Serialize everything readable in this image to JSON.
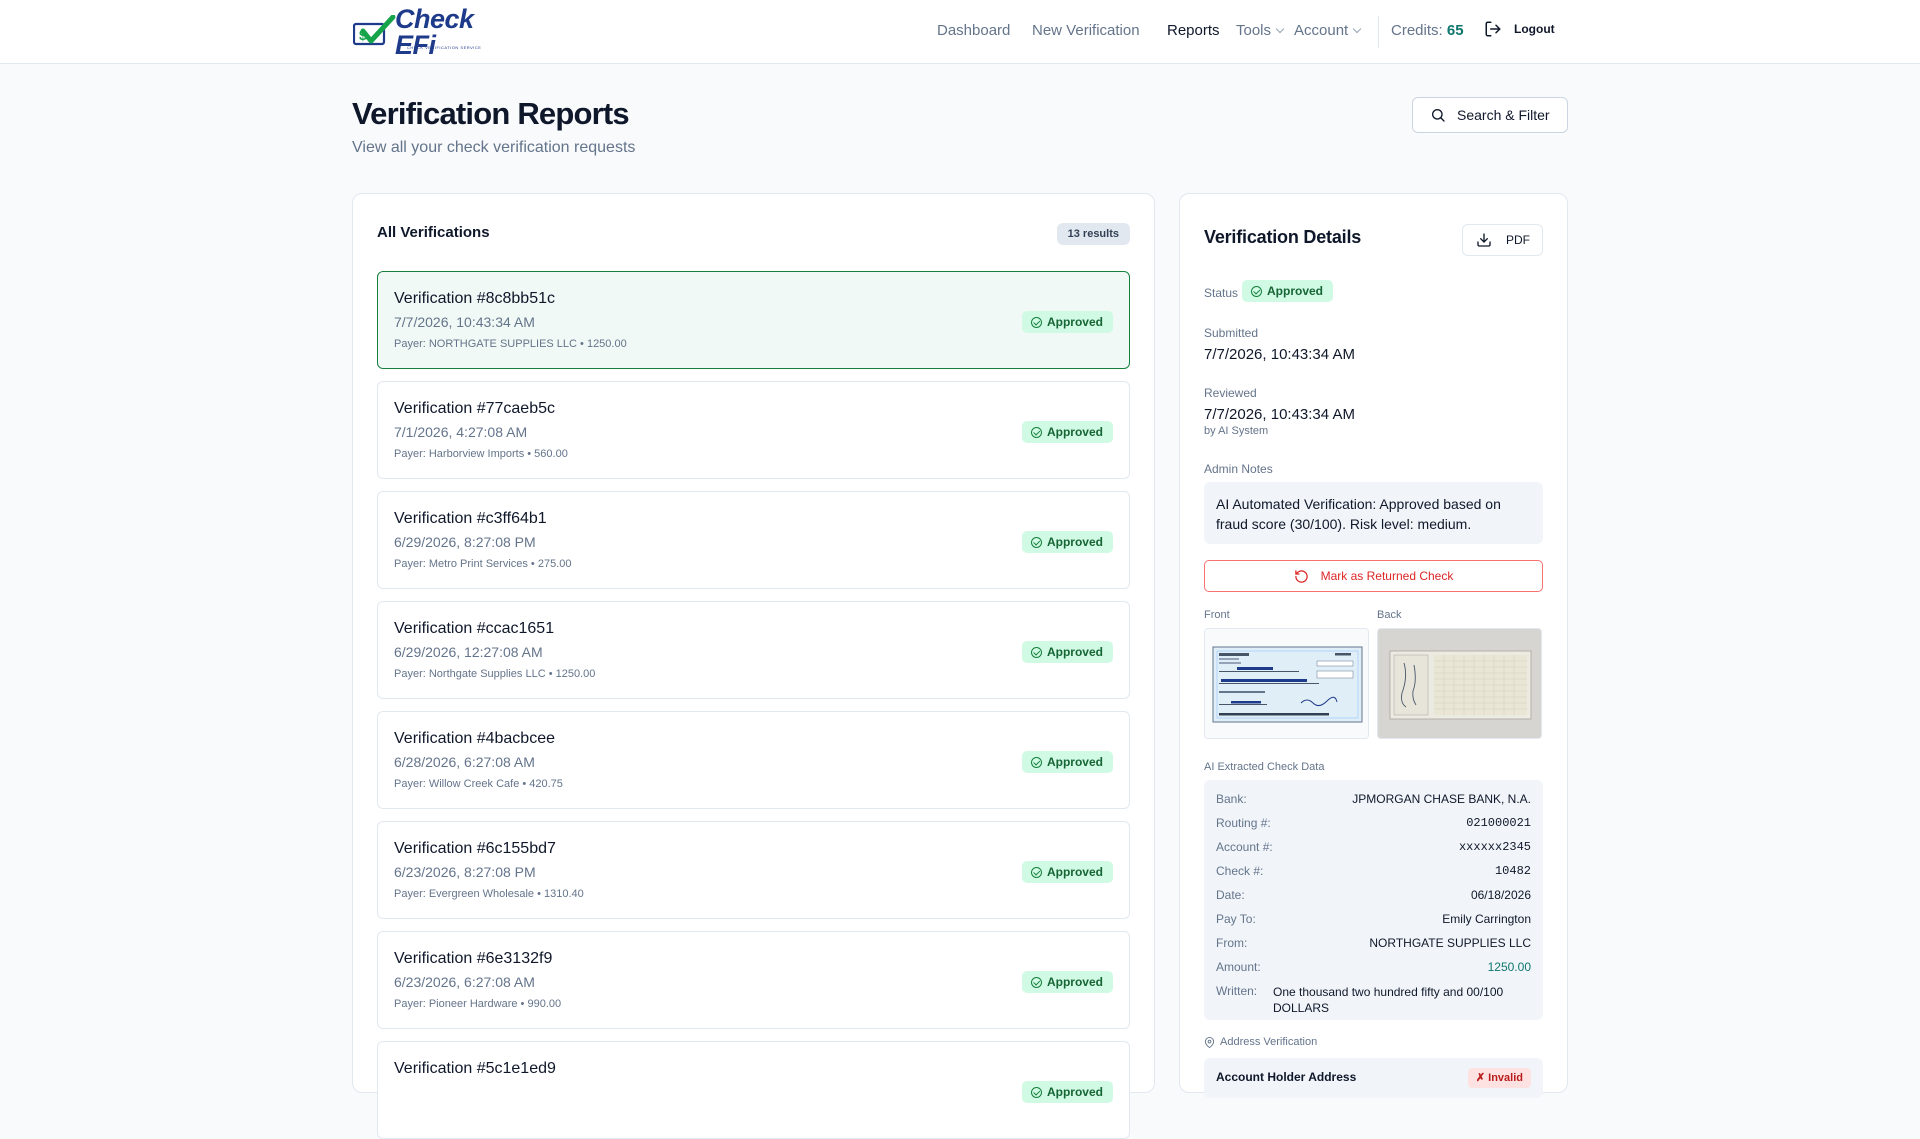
{
  "nav": {
    "logo_text": "Check EFi",
    "logo_sub": "CHECK VERIFICATION SERVICE",
    "links": [
      "Dashboard",
      "New Verification",
      "Reports",
      "Tools",
      "Account"
    ],
    "credits_label": "Credits:",
    "credits_value": "65",
    "logout": "Logout"
  },
  "header": {
    "title": "Verification Reports",
    "subtitle": "View all your check verification requests",
    "search_button": "Search & Filter"
  },
  "list": {
    "title": "All Verifications",
    "count": "13 results",
    "items": [
      {
        "title": "Verification #8c8bb51c",
        "date": "7/7/2026, 10:43:34 AM",
        "payer": "Payer: NORTHGATE SUPPLIES LLC • 1250.00",
        "status": "Approved"
      },
      {
        "title": "Verification #77caeb5c",
        "date": "7/1/2026, 4:27:08 AM",
        "payer": "Payer: Harborview Imports • 560.00",
        "status": "Approved"
      },
      {
        "title": "Verification #c3ff64b1",
        "date": "6/29/2026, 8:27:08 PM",
        "payer": "Payer: Metro Print Services • 275.00",
        "status": "Approved"
      },
      {
        "title": "Verification #ccac1651",
        "date": "6/29/2026, 12:27:08 AM",
        "payer": "Payer: Northgate Supplies LLC • 1250.00",
        "status": "Approved"
      },
      {
        "title": "Verification #4bacbcee",
        "date": "6/28/2026, 6:27:08 AM",
        "payer": "Payer: Willow Creek Cafe • 420.75",
        "status": "Approved"
      },
      {
        "title": "Verification #6c155bd7",
        "date": "6/23/2026, 8:27:08 PM",
        "payer": "Payer: Evergreen Wholesale • 1310.40",
        "status": "Approved"
      },
      {
        "title": "Verification #6e3132f9",
        "date": "6/23/2026, 6:27:08 AM",
        "payer": "Payer: Pioneer Hardware • 990.00",
        "status": "Approved"
      },
      {
        "title": "Verification #5c1e1ed9",
        "date": "",
        "payer": "",
        "status": "Approved"
      }
    ]
  },
  "detail": {
    "title": "Verification Details",
    "pdf_button": "PDF",
    "status_label": "Status",
    "status_value": "Approved",
    "submitted_label": "Submitted",
    "submitted_value": "7/7/2026, 10:43:34 AM",
    "reviewed_label": "Reviewed",
    "reviewed_value": "7/7/2026, 10:43:34 AM",
    "reviewed_by": "by AI System",
    "notes_label": "Admin Notes",
    "notes_value": "AI Automated Verification: Approved based on fraud score (30/100). Risk level: medium.",
    "returned_button": "Mark as Returned Check",
    "front_label": "Front",
    "back_label": "Back",
    "ai_label": "AI Extracted Check Data",
    "ai_fields": [
      {
        "key": "Bank:",
        "value": "JPMORGAN CHASE BANK, N.A.",
        "style": ""
      },
      {
        "key": "Routing #:",
        "value": "021000021",
        "style": "mono"
      },
      {
        "key": "Account #:",
        "value": "xxxxxx2345",
        "style": "mono"
      },
      {
        "key": "Check #:",
        "value": "10482",
        "style": "mono"
      },
      {
        "key": "Date:",
        "value": "06/18/2026",
        "style": ""
      },
      {
        "key": "Pay To:",
        "value": "Emily Carrington",
        "style": ""
      },
      {
        "key": "From:",
        "value": "NORTHGATE SUPPLIES LLC",
        "style": ""
      },
      {
        "key": "Amount:",
        "value": "1250.00",
        "style": "green"
      }
    ],
    "written_label": "Written:",
    "written_value": "One thousand two hundred fifty and 00/100 DOLLARS",
    "address_label": "Address Verification",
    "address_title": "Account Holder Address",
    "address_status": "✗ Invalid"
  },
  "colors": {
    "accent": "#0f766e",
    "approved_bg": "#d1fae5",
    "approved_text": "#166534",
    "danger": "#dc2626"
  }
}
